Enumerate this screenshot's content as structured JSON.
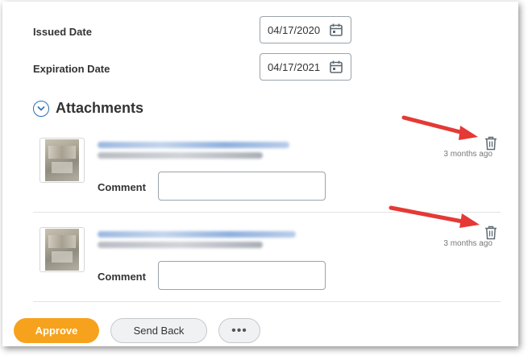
{
  "fields": {
    "issued_label": "Issued Date",
    "issued_value": "04/17/2020",
    "expiration_label": "Expiration Date",
    "expiration_value": "04/17/2021"
  },
  "attachments": {
    "title": "Attachments",
    "items": [
      {
        "comment_label": "Comment",
        "comment_value": "",
        "time_ago": "3 months ago"
      },
      {
        "comment_label": "Comment",
        "comment_value": "",
        "time_ago": "3 months ago"
      }
    ]
  },
  "footer": {
    "approve_label": "Approve",
    "send_back_label": "Send Back",
    "more_label": "•••"
  },
  "icons": {
    "calendar": "calendar-icon",
    "chevron": "chevron-down-icon",
    "trash": "trash-icon",
    "annotation_arrow": "red-arrow"
  },
  "colors": {
    "accent_orange": "#f7a21c",
    "accent_blue": "#2b6fb0",
    "annotation_red": "#e53935",
    "icon_grey": "#5f6a73"
  }
}
